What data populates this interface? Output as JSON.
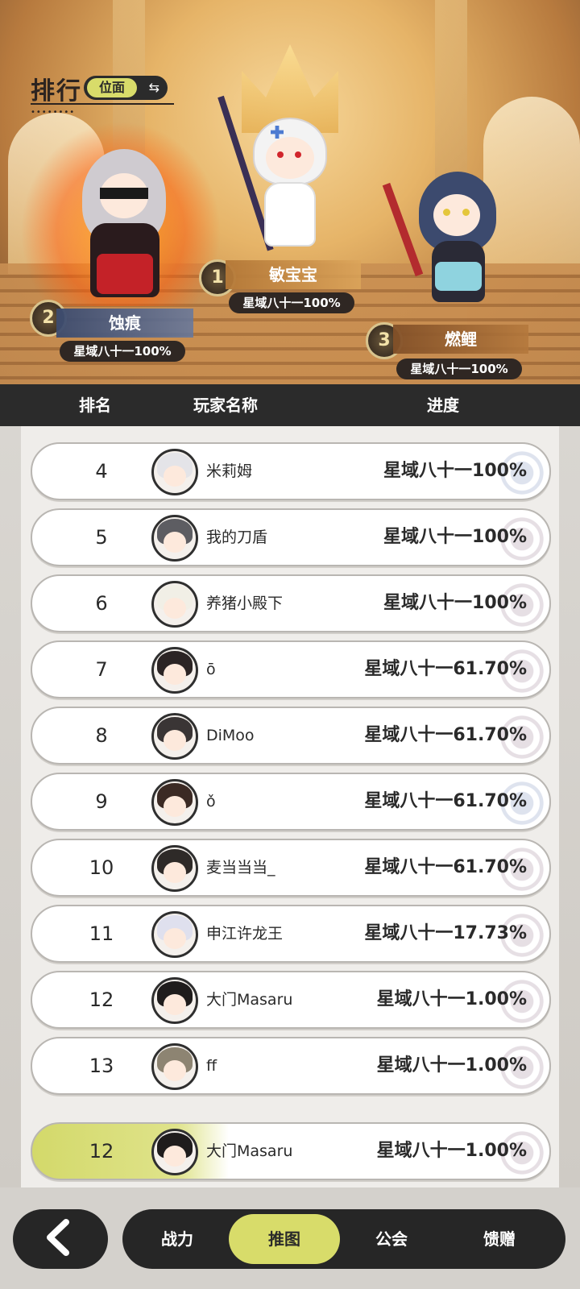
{
  "header": {
    "title": "排行",
    "scope_label": "位面",
    "swap_icon": "swap-arrows-icon"
  },
  "podium": [
    {
      "rank": "1",
      "name": "敏宝宝",
      "progress": "星域八十一100%"
    },
    {
      "rank": "2",
      "name": "蚀痕",
      "progress": "星域八十一100%"
    },
    {
      "rank": "3",
      "name": "燃鲤",
      "progress": "星域八十一100%"
    }
  ],
  "table": {
    "columns": [
      "排名",
      "玩家名称",
      "进度"
    ],
    "rows": [
      {
        "rank": "4",
        "name": "米莉姆",
        "progress": "星域八十一100%"
      },
      {
        "rank": "5",
        "name": "我的刀盾",
        "progress": "星域八十一100%"
      },
      {
        "rank": "6",
        "name": "养猪小殿下",
        "progress": "星域八十一100%"
      },
      {
        "rank": "7",
        "name": "ō",
        "progress": "星域八十一61.70%"
      },
      {
        "rank": "8",
        "name": "DiMoo",
        "progress": "星域八十一61.70%"
      },
      {
        "rank": "9",
        "name": "ǒ",
        "progress": "星域八十一61.70%"
      },
      {
        "rank": "10",
        "name": "麦当当当_",
        "progress": "星域八十一61.70%"
      },
      {
        "rank": "11",
        "name": "申江许龙王",
        "progress": "星域八十一17.73%"
      },
      {
        "rank": "12",
        "name": "大门Masaru",
        "progress": "星域八十一1.00%"
      },
      {
        "rank": "13",
        "name": "ff",
        "progress": "星域八十一1.00%"
      }
    ],
    "self_row": {
      "rank": "12",
      "name": "大门Masaru",
      "progress": "星域八十一1.00%"
    }
  },
  "bottom_nav": {
    "back_icon": "chevron-left-icon",
    "tabs": [
      "战力",
      "推图",
      "公会",
      "馈赠"
    ],
    "active_tab": "推图"
  },
  "colors": {
    "accent": "#d8dc6a",
    "dark": "#262626"
  }
}
